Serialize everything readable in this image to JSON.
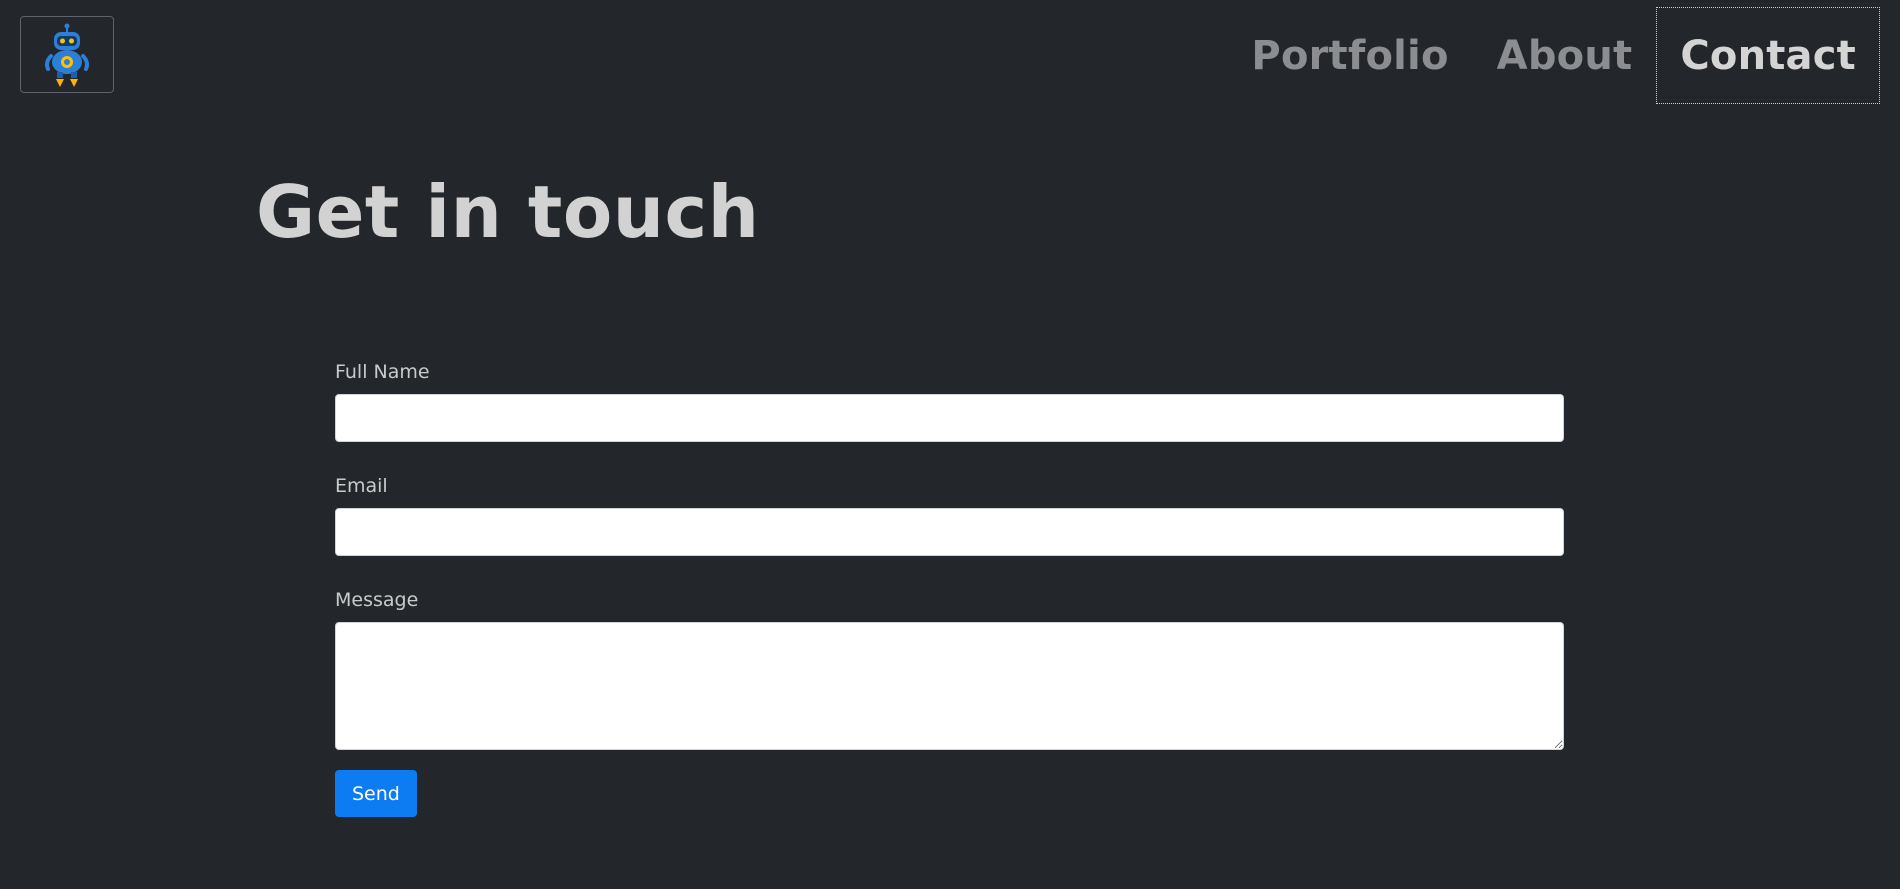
{
  "nav": {
    "items": [
      {
        "label": "Portfolio",
        "active": false
      },
      {
        "label": "About",
        "active": false
      },
      {
        "label": "Contact",
        "active": true
      }
    ]
  },
  "logo": {
    "icon": "robot-icon"
  },
  "main": {
    "title": "Get in touch",
    "form": {
      "full_name_label": "Full Name",
      "full_name_value": "",
      "email_label": "Email",
      "email_value": "",
      "message_label": "Message",
      "message_value": "",
      "send_label": "Send"
    }
  },
  "colors": {
    "background": "#23272b",
    "accent": "#0d7cf2",
    "nav_inactive": "#8b8d90",
    "nav_active": "#d4d4d4"
  }
}
